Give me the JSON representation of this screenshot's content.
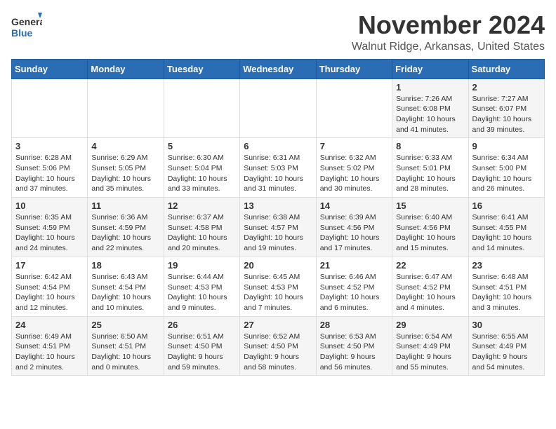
{
  "header": {
    "logo_general": "General",
    "logo_blue": "Blue",
    "month": "November 2024",
    "location": "Walnut Ridge, Arkansas, United States"
  },
  "weekdays": [
    "Sunday",
    "Monday",
    "Tuesday",
    "Wednesday",
    "Thursday",
    "Friday",
    "Saturday"
  ],
  "weeks": [
    [
      {
        "day": "",
        "info": ""
      },
      {
        "day": "",
        "info": ""
      },
      {
        "day": "",
        "info": ""
      },
      {
        "day": "",
        "info": ""
      },
      {
        "day": "",
        "info": ""
      },
      {
        "day": "1",
        "info": "Sunrise: 7:26 AM\nSunset: 6:08 PM\nDaylight: 10 hours and 41 minutes."
      },
      {
        "day": "2",
        "info": "Sunrise: 7:27 AM\nSunset: 6:07 PM\nDaylight: 10 hours and 39 minutes."
      }
    ],
    [
      {
        "day": "3",
        "info": "Sunrise: 6:28 AM\nSunset: 5:06 PM\nDaylight: 10 hours and 37 minutes."
      },
      {
        "day": "4",
        "info": "Sunrise: 6:29 AM\nSunset: 5:05 PM\nDaylight: 10 hours and 35 minutes."
      },
      {
        "day": "5",
        "info": "Sunrise: 6:30 AM\nSunset: 5:04 PM\nDaylight: 10 hours and 33 minutes."
      },
      {
        "day": "6",
        "info": "Sunrise: 6:31 AM\nSunset: 5:03 PM\nDaylight: 10 hours and 31 minutes."
      },
      {
        "day": "7",
        "info": "Sunrise: 6:32 AM\nSunset: 5:02 PM\nDaylight: 10 hours and 30 minutes."
      },
      {
        "day": "8",
        "info": "Sunrise: 6:33 AM\nSunset: 5:01 PM\nDaylight: 10 hours and 28 minutes."
      },
      {
        "day": "9",
        "info": "Sunrise: 6:34 AM\nSunset: 5:00 PM\nDaylight: 10 hours and 26 minutes."
      }
    ],
    [
      {
        "day": "10",
        "info": "Sunrise: 6:35 AM\nSunset: 4:59 PM\nDaylight: 10 hours and 24 minutes."
      },
      {
        "day": "11",
        "info": "Sunrise: 6:36 AM\nSunset: 4:59 PM\nDaylight: 10 hours and 22 minutes."
      },
      {
        "day": "12",
        "info": "Sunrise: 6:37 AM\nSunset: 4:58 PM\nDaylight: 10 hours and 20 minutes."
      },
      {
        "day": "13",
        "info": "Sunrise: 6:38 AM\nSunset: 4:57 PM\nDaylight: 10 hours and 19 minutes."
      },
      {
        "day": "14",
        "info": "Sunrise: 6:39 AM\nSunset: 4:56 PM\nDaylight: 10 hours and 17 minutes."
      },
      {
        "day": "15",
        "info": "Sunrise: 6:40 AM\nSunset: 4:56 PM\nDaylight: 10 hours and 15 minutes."
      },
      {
        "day": "16",
        "info": "Sunrise: 6:41 AM\nSunset: 4:55 PM\nDaylight: 10 hours and 14 minutes."
      }
    ],
    [
      {
        "day": "17",
        "info": "Sunrise: 6:42 AM\nSunset: 4:54 PM\nDaylight: 10 hours and 12 minutes."
      },
      {
        "day": "18",
        "info": "Sunrise: 6:43 AM\nSunset: 4:54 PM\nDaylight: 10 hours and 10 minutes."
      },
      {
        "day": "19",
        "info": "Sunrise: 6:44 AM\nSunset: 4:53 PM\nDaylight: 10 hours and 9 minutes."
      },
      {
        "day": "20",
        "info": "Sunrise: 6:45 AM\nSunset: 4:53 PM\nDaylight: 10 hours and 7 minutes."
      },
      {
        "day": "21",
        "info": "Sunrise: 6:46 AM\nSunset: 4:52 PM\nDaylight: 10 hours and 6 minutes."
      },
      {
        "day": "22",
        "info": "Sunrise: 6:47 AM\nSunset: 4:52 PM\nDaylight: 10 hours and 4 minutes."
      },
      {
        "day": "23",
        "info": "Sunrise: 6:48 AM\nSunset: 4:51 PM\nDaylight: 10 hours and 3 minutes."
      }
    ],
    [
      {
        "day": "24",
        "info": "Sunrise: 6:49 AM\nSunset: 4:51 PM\nDaylight: 10 hours and 2 minutes."
      },
      {
        "day": "25",
        "info": "Sunrise: 6:50 AM\nSunset: 4:51 PM\nDaylight: 10 hours and 0 minutes."
      },
      {
        "day": "26",
        "info": "Sunrise: 6:51 AM\nSunset: 4:50 PM\nDaylight: 9 hours and 59 minutes."
      },
      {
        "day": "27",
        "info": "Sunrise: 6:52 AM\nSunset: 4:50 PM\nDaylight: 9 hours and 58 minutes."
      },
      {
        "day": "28",
        "info": "Sunrise: 6:53 AM\nSunset: 4:50 PM\nDaylight: 9 hours and 56 minutes."
      },
      {
        "day": "29",
        "info": "Sunrise: 6:54 AM\nSunset: 4:49 PM\nDaylight: 9 hours and 55 minutes."
      },
      {
        "day": "30",
        "info": "Sunrise: 6:55 AM\nSunset: 4:49 PM\nDaylight: 9 hours and 54 minutes."
      }
    ]
  ]
}
